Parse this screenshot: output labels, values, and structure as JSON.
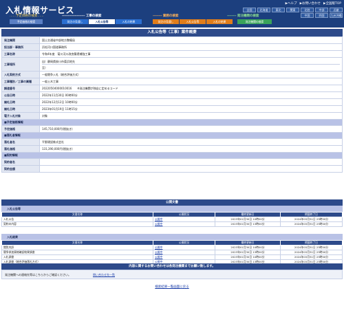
{
  "header": {
    "logo": "入札情報サービス",
    "toplinks": [
      "▶ヘルプ",
      "▶お問い合わせ",
      "▶全国版TOP"
    ],
    "regions_row1": [
      "全国",
      "北海道",
      "東北",
      "関東",
      "北陸",
      "中部",
      "近畿"
    ],
    "regions_row2": [
      "中国",
      "四国",
      "九州沖縄"
    ]
  },
  "nav": {
    "sections": [
      {
        "title": "工事の検索",
        "dashes": "--------------------"
      },
      {
        "title": "業務の検索",
        "dashes": "--------"
      },
      {
        "title": "発注機関の検索",
        "dashes": "--------"
      }
    ],
    "left_label": "……予定価格の検索……",
    "tabs_left": [
      "予定価格の検索"
    ],
    "tabs_work": [
      "発注の見通し",
      "入札公告等",
      "入札の結果"
    ],
    "tabs_service": [
      "発注の見通し",
      "入札公告等",
      "入札の結果"
    ],
    "tabs_agency": [
      "発注機関の検索"
    ]
  },
  "title": "入札公告等（工事）案件概要",
  "detail": {
    "rows": [
      {
        "label": "発注機関",
        "value": "国土交通省中部地方整備局"
      },
      {
        "label": "担当部・事務所",
        "value": "浜松河川国道事務所"
      },
      {
        "label": "工事名称",
        "value": "令和4年度　菊川河川改良築堤補強工事"
      },
      {
        "label": "工事場所",
        "value": "自）静岡県掛川市菊浜地先",
        "value2": "至）"
      },
      {
        "label": "入札契約方式",
        "value": "一般競争入札（総合評価方式）"
      },
      {
        "label": "工事種別／工事の業種",
        "value": "一般土木工事"
      },
      {
        "label": "調達番号",
        "value": "20220504000010016　　※発注機関が独自に定めるコード"
      },
      {
        "label": "公告日時",
        "value": "2022年11月30日 00時00分"
      },
      {
        "label": "開札日時",
        "value": "2022年12月12日 10時00分"
      },
      {
        "label": "開札日時",
        "value": "2023年01月19日 11時15分"
      },
      {
        "label": "電子入札対象",
        "value": "対象"
      }
    ],
    "section_price": "■予定価格情報",
    "price_label": "予定価格",
    "price_value": "145,710,000円(税抜き)",
    "section_award": "■落札者情報",
    "award_name_label": "落札者名",
    "award_name_value": "平野建設株式会社",
    "award_price_label": "落札価格",
    "award_price_value": "131,390,000円(税抜き)",
    "section_contract": "■契約情報",
    "contract_label": "契約者名",
    "contract_price_label": "契約金額"
  },
  "public_docs": {
    "heading": "公開文書",
    "columns": [
      "文書名称",
      "公開状況",
      "最終更新日",
      "掲載終了日"
    ],
    "block1": {
      "title": "入札公告等",
      "rows": [
        [
          "入札公告",
          "公開中",
          "2023年01月30日 10時00分",
          "2024年03月31日 23時00分"
        ],
        [
          "契約の内容",
          "公開中",
          "2023年01月30日 13時00分",
          "2024年03月31日 23時00分"
        ]
      ]
    },
    "block2": {
      "title": "入札結果",
      "rows": [
        [
          "閲覧内訳",
          "公開中",
          "2023年01月30日 10時00分",
          "2024年03月31日 23時00分"
        ],
        [
          "競争参加資格確認結果調書",
          "公開中",
          "2023年01月30日 13時00分",
          "2024年03月31日 23時00分"
        ],
        [
          "入札調書",
          "公開中",
          "2023年01月30日 10時00分",
          "2024年03月31日 23時00分"
        ],
        [
          "入札調書（総合評価落札方式）",
          "公開中",
          "2023年01月30日 13時00分",
          "2024年03月31日 23時00分"
        ]
      ]
    }
  },
  "inquiry": {
    "bar": "内容に関するお問い合わせは各発注機関までお願い致します。",
    "text": "発注機関への連絡先等はこちらからご確認ください。",
    "link": "問い合わせ先一覧"
  },
  "back_link": "検索結果一覧画面に戻る",
  "colors": {
    "header": "#1c3f7e",
    "work": "#2b6fd1",
    "service": "#e07d1a",
    "agency": "#3aa35a",
    "bar": "#2d4a8a"
  }
}
